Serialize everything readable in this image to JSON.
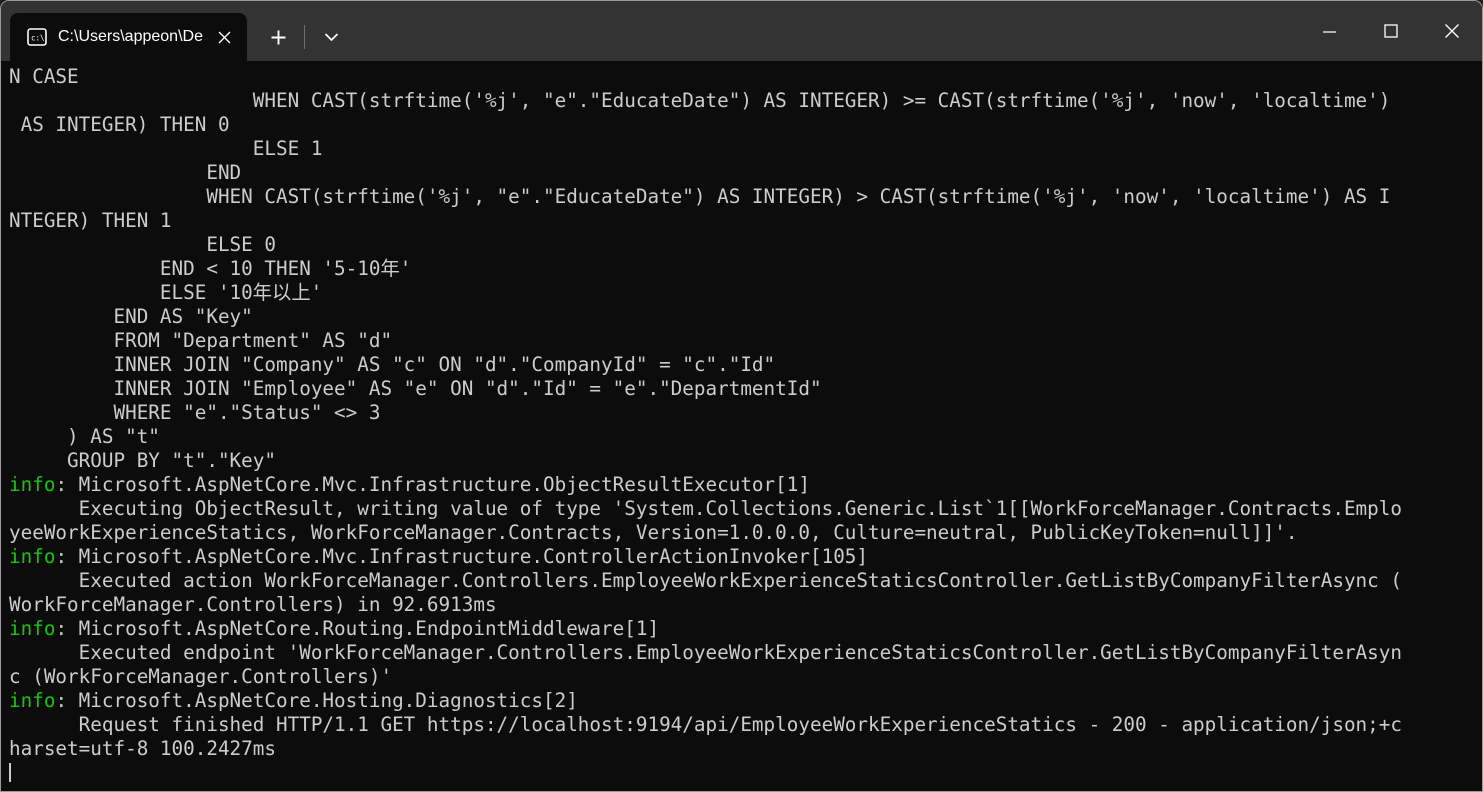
{
  "window": {
    "title": "C:\\Users\\appeon\\Desktop\\Sou",
    "app": "Windows Terminal",
    "background": "#0c0c0c",
    "titlebar_background": "#333333",
    "border_color": "#9a9a9a"
  },
  "tab": {
    "icon": "cmd-prompt-icon",
    "label": "C:\\Users\\appeon\\Desktop\\Sou",
    "close_glyph": "✕"
  },
  "tab_actions": {
    "new_tab_glyph": "+",
    "new_tab_name": "new-tab",
    "dropdown_glyph": "⌄",
    "dropdown_name": "tab-dropdown"
  },
  "caption": {
    "minimize_glyph": "─",
    "maximize_glyph": "□",
    "close_glyph": "✕"
  },
  "console": {
    "fg": "#cccccc",
    "info_color": "#16c60c",
    "lines": [
      {
        "text": "N CASE"
      },
      {
        "text": "                     WHEN CAST(strftime('%j', \"e\".\"EducateDate\") AS INTEGER) >= CAST(strftime('%j', 'now', 'localtime')"
      },
      {
        "text": " AS INTEGER) THEN 0"
      },
      {
        "text": "                     ELSE 1"
      },
      {
        "text": "                 END"
      },
      {
        "text": "                 WHEN CAST(strftime('%j', \"e\".\"EducateDate\") AS INTEGER) > CAST(strftime('%j', 'now', 'localtime') AS I"
      },
      {
        "text": "NTEGER) THEN 1"
      },
      {
        "text": "                 ELSE 0"
      },
      {
        "text": "             END < 10 THEN '5-10年'"
      },
      {
        "text": "             ELSE '10年以上'"
      },
      {
        "text": "         END AS \"Key\""
      },
      {
        "text": "         FROM \"Department\" AS \"d\""
      },
      {
        "text": "         INNER JOIN \"Company\" AS \"c\" ON \"d\".\"CompanyId\" = \"c\".\"Id\""
      },
      {
        "text": "         INNER JOIN \"Employee\" AS \"e\" ON \"d\".\"Id\" = \"e\".\"DepartmentId\""
      },
      {
        "text": "         WHERE \"e\".\"Status\" <> 3"
      },
      {
        "text": "     ) AS \"t\""
      },
      {
        "text": "     GROUP BY \"t\".\"Key\""
      },
      {
        "level": "info",
        "text": ": Microsoft.AspNetCore.Mvc.Infrastructure.ObjectResultExecutor[1]"
      },
      {
        "text": "      Executing ObjectResult, writing value of type 'System.Collections.Generic.List`1[[WorkForceManager.Contracts.Emplo"
      },
      {
        "text": "yeeWorkExperienceStatics, WorkForceManager.Contracts, Version=1.0.0.0, Culture=neutral, PublicKeyToken=null]]'."
      },
      {
        "level": "info",
        "text": ": Microsoft.AspNetCore.Mvc.Infrastructure.ControllerActionInvoker[105]"
      },
      {
        "text": "      Executed action WorkForceManager.Controllers.EmployeeWorkExperienceStaticsController.GetListByCompanyFilterAsync ("
      },
      {
        "text": "WorkForceManager.Controllers) in 92.6913ms"
      },
      {
        "level": "info",
        "text": ": Microsoft.AspNetCore.Routing.EndpointMiddleware[1]"
      },
      {
        "text": "      Executed endpoint 'WorkForceManager.Controllers.EmployeeWorkExperienceStaticsController.GetListByCompanyFilterAsyn"
      },
      {
        "text": "c (WorkForceManager.Controllers)'"
      },
      {
        "level": "info",
        "text": ": Microsoft.AspNetCore.Hosting.Diagnostics[2]"
      },
      {
        "text": "      Request finished HTTP/1.1 GET https://localhost:9194/api/EmployeeWorkExperienceStatics - 200 - application/json;+c"
      },
      {
        "text": "harset=utf-8 100.2427ms"
      }
    ],
    "level_label": "info",
    "cursor_visible": true
  }
}
